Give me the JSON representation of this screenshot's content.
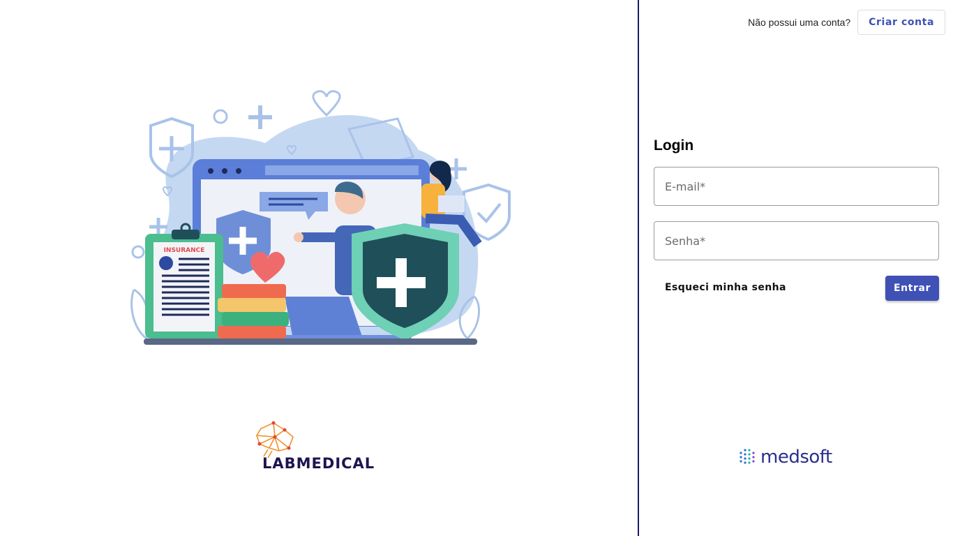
{
  "header": {
    "signup_prompt": "Não possui uma conta?",
    "signup_button": "Criar conta"
  },
  "login": {
    "title": "Login",
    "email_placeholder": "E-mail*",
    "password_placeholder": "Senha*",
    "forgot_password": "Esqueci minha senha",
    "submit": "Entrar"
  },
  "illustration": {
    "card_label": "INSURANCE"
  },
  "brand": {
    "app_logo_text": "LABMEDICAL",
    "partner_logo_text": "medsoft"
  },
  "colors": {
    "accent": "#3f51b5",
    "divider": "#1a1a6e",
    "brand_dark": "#1c1550"
  }
}
